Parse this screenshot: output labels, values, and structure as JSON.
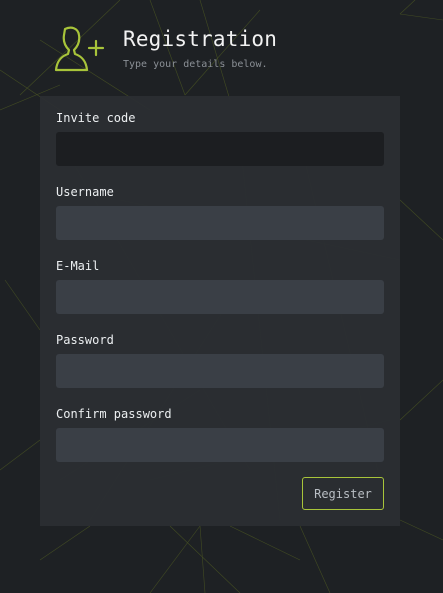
{
  "header": {
    "icon": "add-user-icon",
    "title": "Registration",
    "subtitle": "Type your details below."
  },
  "form": {
    "fields": [
      {
        "label": "Invite code",
        "value": "",
        "state": "focused"
      },
      {
        "label": "Username",
        "value": ""
      },
      {
        "label": "E-Mail",
        "value": ""
      },
      {
        "label": "Password",
        "value": ""
      },
      {
        "label": "Confirm password",
        "value": ""
      }
    ],
    "submit_label": "Register"
  },
  "colors": {
    "background": "#1e2124",
    "panel": "#2b2e33",
    "input": "#3a3f46",
    "input_focused": "#1c1e21",
    "accent": "#a8c43a"
  }
}
